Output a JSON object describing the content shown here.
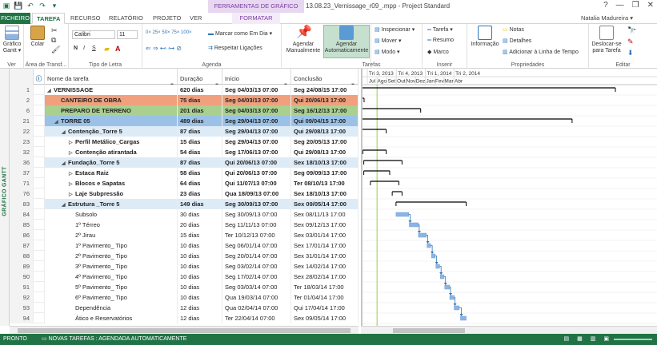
{
  "titlebar": {
    "context_tab_header": "FERRAMENTAS DE GRÁFICO GANTT",
    "document_title": "13.08.23_Vernissage_r09_.mpp - Project Standard",
    "help": "?",
    "minimize": "—",
    "restore": "❐",
    "close": "✕"
  },
  "tabs": {
    "file": "FICHEIRO",
    "items": [
      "TAREFA",
      "RECURSO",
      "RELATÓRIO",
      "PROJETO",
      "VER",
      "FORMATAR"
    ],
    "active": "TAREFA",
    "user": "Natalia Madureira ▾"
  },
  "ribbon": {
    "ver": {
      "label": "Ver",
      "button": "Gráfico Gantt ▾"
    },
    "clipboard": {
      "label": "Área de Transf...",
      "paste": "Colar"
    },
    "font": {
      "label": "Tipo de Letra",
      "family": "Calibri",
      "size": "11",
      "bold": "N",
      "italic": "I",
      "underline": "S"
    },
    "schedule": {
      "label": "Agenda",
      "mark_on_track": "Marcar como Em Dia",
      "respect_links": "Respeitar Ligações"
    },
    "tasks": {
      "label": "Tarefas",
      "manual": "Agendar Manualmente",
      "auto": "Agendar Automaticamente",
      "inspect": "Inspecionar",
      "move": "Mover",
      "mode": "Modo"
    },
    "insert": {
      "label": "Inserir",
      "task": "Tarefa",
      "summary": "Resumo",
      "milestone": "Marco"
    },
    "properties": {
      "label": "Propriedades",
      "info": "Informação",
      "notes": "Notas",
      "details": "Detalhes",
      "add_timeline": "Adicionar à Linha de Tempo"
    },
    "editing": {
      "label": "Editar",
      "scroll_to_task": "Deslocar-se para Tarefa"
    }
  },
  "side_label": "GRÁFICO GANTT",
  "grid": {
    "columns": {
      "name": "Nome da tarefa",
      "duration": "Duração",
      "start": "Início",
      "end": "Conclusão"
    },
    "rows": [
      {
        "id": "1",
        "name": "VERNISSAGE",
        "dur": "620 dias",
        "start": "Seg 04/03/13 07:00",
        "end": "Seg 24/08/15 17:00",
        "level": 0,
        "summary": true,
        "bold": true,
        "bg": "#ffffff"
      },
      {
        "id": "2",
        "name": "CANTEIRO DE OBRA",
        "dur": "75 dias",
        "start": "Seg 04/03/13 07:00",
        "end": "Qui 20/06/13 17:00",
        "level": 1,
        "summary": false,
        "bold": true,
        "bg": "#f0a07d"
      },
      {
        "id": "6",
        "name": "PREPARO DE TERRENO",
        "dur": "201 dias",
        "start": "Seg 04/03/13 07:00",
        "end": "Seg 16/12/13 17:00",
        "level": 1,
        "summary": false,
        "bold": true,
        "bg": "#a9d08e"
      },
      {
        "id": "21",
        "name": "TORRE 05",
        "dur": "489 dias",
        "start": "Seg 29/04/13 07:00",
        "end": "Qui 09/04/15 17:00",
        "level": 1,
        "summary": true,
        "bold": true,
        "bg": "#9bc2e6"
      },
      {
        "id": "22",
        "name": "Contenção_Torre 5",
        "dur": "87 dias",
        "start": "Seg 29/04/13 07:00",
        "end": "Qui 29/08/13 17:00",
        "level": 2,
        "summary": true,
        "bold": true,
        "bg": "#ddebf7"
      },
      {
        "id": "23",
        "name": "Perfil Metálico_Cargas",
        "dur": "15 dias",
        "start": "Seg 29/04/13 07:00",
        "end": "Seg 20/05/13 17:00",
        "level": 3,
        "summary": true,
        "collapsed": true,
        "bold": true,
        "bg": "#ffffff"
      },
      {
        "id": "32",
        "name": "Contenção atirantada",
        "dur": "54 dias",
        "start": "Seg 17/06/13 07:00",
        "end": "Qui 29/08/13 17:00",
        "level": 3,
        "summary": true,
        "collapsed": true,
        "bold": true,
        "bg": "#ffffff"
      },
      {
        "id": "36",
        "name": "Fundação_Torre 5",
        "dur": "87 dias",
        "start": "Qui 20/06/13 07:00",
        "end": "Sex 18/10/13 17:00",
        "level": 2,
        "summary": true,
        "bold": true,
        "bg": "#ddebf7"
      },
      {
        "id": "37",
        "name": "Estaca Raiz",
        "dur": "58 dias",
        "start": "Qui 20/06/13 07:00",
        "end": "Seg 09/09/13 17:00",
        "level": 3,
        "summary": true,
        "collapsed": true,
        "bold": true,
        "bg": "#ffffff"
      },
      {
        "id": "71",
        "name": "Blocos e Sapatas",
        "dur": "64 dias",
        "start": "Qui 11/07/13 07:00",
        "end": "Ter 08/10/13 17:00",
        "level": 3,
        "summary": true,
        "collapsed": true,
        "bold": true,
        "bg": "#ffffff"
      },
      {
        "id": "76",
        "name": "Laje Subpressão",
        "dur": "23 dias",
        "start": "Qua 18/09/13 07:00",
        "end": "Sex 18/10/13 17:00",
        "level": 3,
        "summary": true,
        "collapsed": true,
        "bold": true,
        "bg": "#ffffff"
      },
      {
        "id": "83",
        "name": "Estrutura _Torre 5",
        "dur": "149 dias",
        "start": "Seg 30/09/13 07:00",
        "end": "Sex 09/05/14 17:00",
        "level": 2,
        "summary": true,
        "bold": true,
        "bg": "#ddebf7"
      },
      {
        "id": "84",
        "name": "Subsolo",
        "dur": "30 dias",
        "start": "Seg 30/09/13 07:00",
        "end": "Sex 08/11/13 17:00",
        "level": 3,
        "summary": false,
        "bold": false,
        "bg": "#ffffff"
      },
      {
        "id": "85",
        "name": "1º Térreo",
        "dur": "20 dias",
        "start": "Seg 11/11/13 07:00",
        "end": "Sex 09/12/13 17:00",
        "level": 3,
        "summary": false,
        "bold": false,
        "bg": "#ffffff"
      },
      {
        "id": "86",
        "name": "2º Jirau",
        "dur": "15 dias",
        "start": "Ter 10/12/13 07:00",
        "end": "Sex 03/01/14 17:00",
        "level": 3,
        "summary": false,
        "bold": false,
        "bg": "#ffffff"
      },
      {
        "id": "87",
        "name": "1º Pavimento_ Tipo",
        "dur": "10 dias",
        "start": "Seg 06/01/14 07:00",
        "end": "Sex 17/01/14 17:00",
        "level": 3,
        "summary": false,
        "bold": false,
        "bg": "#ffffff"
      },
      {
        "id": "88",
        "name": "2º Pavimento_ Tipo",
        "dur": "10 dias",
        "start": "Seg 20/01/14 07:00",
        "end": "Sex 31/01/14 17:00",
        "level": 3,
        "summary": false,
        "bold": false,
        "bg": "#ffffff"
      },
      {
        "id": "89",
        "name": "3º Pavimento_ Tipo",
        "dur": "10 dias",
        "start": "Seg 03/02/14 07:00",
        "end": "Sex 14/02/14 17:00",
        "level": 3,
        "summary": false,
        "bold": false,
        "bg": "#ffffff"
      },
      {
        "id": "90",
        "name": "4º Pavimento_ Tipo",
        "dur": "10 dias",
        "start": "Seg 17/02/14 07:00",
        "end": "Sex 28/02/14 17:00",
        "level": 3,
        "summary": false,
        "bold": false,
        "bg": "#ffffff"
      },
      {
        "id": "91",
        "name": "5º Pavimento_ Tipo",
        "dur": "10 dias",
        "start": "Seg 03/03/14 07:00",
        "end": "Ter 18/03/14 17:00",
        "level": 3,
        "summary": false,
        "bold": false,
        "bg": "#ffffff"
      },
      {
        "id": "92",
        "name": "6º Pavimento_ Tipo",
        "dur": "10 dias",
        "start": "Qua 19/03/14 07:00",
        "end": "Ter 01/04/14 17:00",
        "level": 3,
        "summary": false,
        "bold": false,
        "bg": "#ffffff"
      },
      {
        "id": "93",
        "name": "Dependência",
        "dur": "12 dias",
        "start": "Qua 02/04/14 07:00",
        "end": "Qui 17/04/14 17:00",
        "level": 3,
        "summary": false,
        "bold": false,
        "bg": "#ffffff"
      },
      {
        "id": "94",
        "name": "Ático e Reservatórios",
        "dur": "12 dias",
        "start": "Ter 22/04/14 07:00",
        "end": "Sex 09/05/14 17:00",
        "level": 3,
        "summary": false,
        "bold": false,
        "bg": "#ffffff"
      }
    ]
  },
  "gantt": {
    "tiers_top": [
      "Tri 3, 2013",
      "Tri 4, 2013",
      "Tri 1, 2014",
      "Tri 2, 2014"
    ],
    "tiers_bottom": [
      "Jul",
      "Ago",
      "Set",
      "Out",
      "Nov",
      "Dez",
      "Jan",
      "Fev",
      "Mar",
      "Abr"
    ],
    "timescale_start": "2013-06-16",
    "today": "2013-08-01",
    "bar_color": "#8db4e2",
    "summary_color": "#000000",
    "today_color": "#92d050"
  },
  "status": {
    "ready": "PRONTO",
    "new_tasks": "NOVAS TAREFAS : AGENDADA AUTOMATICAMENTE"
  }
}
